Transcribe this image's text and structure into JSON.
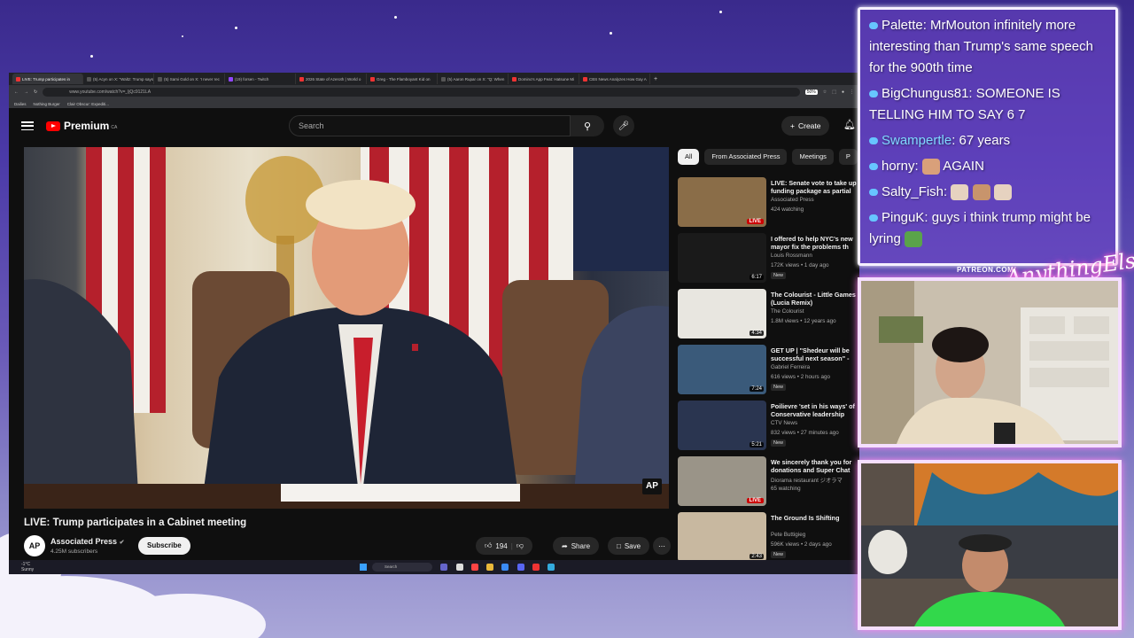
{
  "browser": {
    "tabs": [
      "LIVE: Trump participates in",
      "(5) Acyn on X: \"Waltz: Trump says",
      "(5) Sami Gold on X: 'I never rec",
      "(19) forsen - Twitch",
      "2026 State of Azeroth | World o",
      "Greg - The Flamboyant Kid on",
      "(5) Aaron Rupar on X: \"Q: When",
      "Domino's App Feat: Hatsune Mi",
      "CBS News Analyzes How Gay A"
    ],
    "url": "www.youtube.com/watch?v=_ljQc9121LA",
    "zoom": "50%",
    "bookmarks": [
      "Dailies",
      "Nothing Burger",
      "Clair Obscur: Expediti..."
    ]
  },
  "youtube": {
    "logo": "Premium",
    "logo_region": "CA",
    "search_placeholder": "Search",
    "create_label": "Create",
    "video_title": "LIVE: Trump participates in a Cabinet meeting",
    "channel": {
      "name": "Associated Press",
      "avatar_text": "AP",
      "subscribers": "4.25M subscribers",
      "subscribe_label": "Subscribe"
    },
    "actions": {
      "likes": "194",
      "share": "Share",
      "save": "Save"
    },
    "player_badge": "AP",
    "chips": [
      "All",
      "From Associated Press",
      "Meetings",
      "P"
    ],
    "recommendations": [
      {
        "title": "LIVE: Senate vote to take up funding package as partial",
        "channel": "Associated Press",
        "meta": "424 watching",
        "badge": "LIVE",
        "new": "",
        "thumb_color": "#8a6d48"
      },
      {
        "title": "I offered to help NYC's new mayor fix the problems th",
        "channel": "Louis Rossmann",
        "meta": "172K views • 1 day ago",
        "badge": "6:17",
        "new": "New",
        "thumb_color": "#1a1a1a"
      },
      {
        "title": "The Colourist - Little Games (Lucia Remix)",
        "channel": "The Colourist",
        "meta": "1.8M views • 12 years ago",
        "badge": "4:34",
        "new": "",
        "thumb_color": "#e8e6e0"
      },
      {
        "title": "GET UP | \"Shedeur will be successful next season\" -",
        "channel": "Gabriel Ferreira",
        "meta": "616 views • 2 hours ago",
        "badge": "7:24",
        "new": "New",
        "thumb_color": "#3a5a7a"
      },
      {
        "title": "Poilievre 'set in his ways' of Conservative leadership",
        "channel": "CTV News",
        "meta": "832 views • 27 minutes ago",
        "badge": "5:21",
        "new": "New",
        "thumb_color": "#2a3550"
      },
      {
        "title": "We sincerely thank you for donations and Super Chat",
        "channel": "Diorama restaurant ジオラマ",
        "meta": "65 watching",
        "badge": "LIVE",
        "new": "",
        "thumb_color": "#9a9488"
      },
      {
        "title": "The Ground Is Shifting",
        "channel": "Pete Buttigieg",
        "meta": "596K views • 2 days ago",
        "badge": "2:43",
        "new": "New",
        "thumb_color": "#c8b8a0"
      }
    ]
  },
  "taskbar": {
    "weather_temp": "-1°C",
    "weather_desc": "Sunny",
    "search": "Search"
  },
  "chat": [
    {
      "user": "Palette",
      "text": "MrMouton infinitely more interesting than Trump's same speech for the 900th time",
      "color": "#ffffff"
    },
    {
      "user": "BigChungus81",
      "text": "SOMEONE IS TELLING HIM TO SAY 6 7",
      "color": "#ffffff"
    },
    {
      "user": "Swampertle",
      "text": "67 years",
      "color": "#7fd8ff"
    },
    {
      "user": "horny",
      "text": "AGAIN",
      "color": "#ffffff"
    },
    {
      "user": "Salty_Fish",
      "text": "",
      "color": "#ffffff"
    },
    {
      "user": "PinguK",
      "text": "guys i think trump might be lyring",
      "color": "#ffffff"
    }
  ],
  "overlay": {
    "patreon": "PATREON.COM/",
    "logo_text": "AnythingElse"
  }
}
